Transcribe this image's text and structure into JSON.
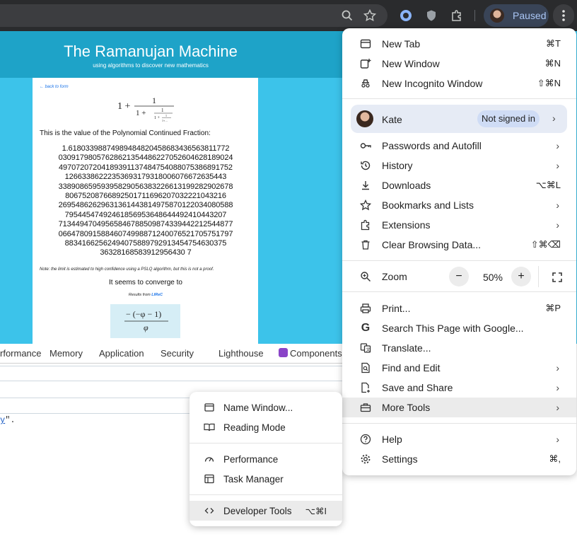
{
  "browser": {
    "profile_status": "Paused"
  },
  "page": {
    "title": "The Ramanujan Machine",
    "subtitle": "using algorithms to discover new mathematics",
    "back_link": "← back to form",
    "cf_description": "This is the value of the Polynomial Continued Fraction:",
    "cf_value": "1.61803398874989484820458683436563811772\n03091798057628621354486227052604628189024\n49707207204189391137484754088075386891752\n12663386222353693179318006076672635443\n33890865959395829056383226613199282902678\n80675208766892501711696207032221043216\n26954862629631361443814975870122034080588\n79544547492461856953648644492410443207\n71344947049565846788509874339442212544877\n06647809158846074998871240076521705751797\n88341662562494075889792913454754630375\n36328168583912956430 7",
    "note": "Note: the limit is estimated to high confidence using a PSLQ algorithm, but this is not a proof.",
    "converge_text": "It seems to converge to",
    "results_prefix": "Results from",
    "results_link": "LIReC"
  },
  "devtools": {
    "tabs": [
      "rformance",
      "Memory",
      "Application",
      "Security",
      "Lighthouse",
      "Components"
    ],
    "console_link": "y",
    "console_text": "\"."
  },
  "main_menu": {
    "items": [
      {
        "label": "New Tab",
        "shortcut": "⌘T",
        "icon": "new-tab-icon"
      },
      {
        "label": "New Window",
        "shortcut": "⌘N",
        "icon": "new-window-icon"
      },
      {
        "label": "New Incognito Window",
        "shortcut": "⇧⌘N",
        "icon": "incognito-icon"
      },
      {
        "label": "Passwords and Autofill",
        "icon": "key-icon"
      },
      {
        "label": "History",
        "icon": "history-icon"
      },
      {
        "label": "Downloads",
        "shortcut": "⌥⌘L",
        "icon": "download-icon"
      },
      {
        "label": "Bookmarks and Lists",
        "icon": "star-icon"
      },
      {
        "label": "Extensions",
        "icon": "extension-icon"
      },
      {
        "label": "Clear Browsing Data...",
        "shortcut": "⇧⌘⌫",
        "icon": "trash-icon"
      },
      {
        "label": "Zoom",
        "icon": "zoom-icon"
      },
      {
        "label": "Print...",
        "shortcut": "⌘P",
        "icon": "print-icon"
      },
      {
        "label": "Search This Page with Google...",
        "icon": "google-icon"
      },
      {
        "label": "Translate...",
        "icon": "translate-icon"
      },
      {
        "label": "Find and Edit",
        "icon": "find-icon"
      },
      {
        "label": "Save and Share",
        "icon": "save-share-icon"
      },
      {
        "label": "More Tools",
        "icon": "toolbox-icon"
      },
      {
        "label": "Help",
        "icon": "help-icon"
      },
      {
        "label": "Settings",
        "shortcut": "⌘,",
        "icon": "gear-icon"
      }
    ],
    "profile": {
      "name": "Kate",
      "status": "Not signed in"
    },
    "zoom": {
      "value": "50%",
      "minus": "−",
      "plus": "+"
    }
  },
  "sub_menu": {
    "items": [
      {
        "label": "Name Window...",
        "icon": "window-icon"
      },
      {
        "label": "Reading Mode",
        "icon": "book-icon"
      },
      {
        "label": "Performance",
        "icon": "gauge-icon"
      },
      {
        "label": "Task Manager",
        "icon": "task-manager-icon"
      },
      {
        "label": "Developer Tools",
        "shortcut": "⌥⌘I",
        "icon": "code-icon"
      }
    ]
  },
  "colors": {
    "page_bg": "#3cc3ea",
    "header_bg": "#1ea3c8",
    "toolbar_bg": "#2a2b2d",
    "menu_highlight": "#ebebeb"
  }
}
